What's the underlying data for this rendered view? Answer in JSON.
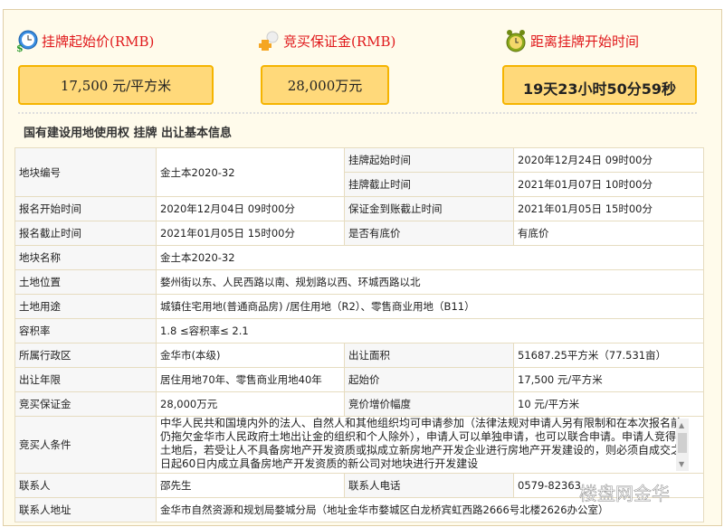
{
  "header": {
    "start_price": {
      "label": "挂牌起始价(RMB)",
      "value": "17,500 元/平方米",
      "icon": "clock-money-icon"
    },
    "deposit": {
      "label": "竞买保证金(RMB)",
      "value": "28,000万元",
      "icon": "money-bag-icon"
    },
    "countdown": {
      "label": "距离挂牌开始时间",
      "value": "19天23小时50分59秒",
      "icon": "alarm-clock-icon"
    }
  },
  "section_title": "国有建设用地使用权 挂牌 出让基本信息",
  "table": {
    "plot_no_label": "地块编号",
    "plot_no": "金土本2020-32",
    "list_start_label": "挂牌起始时间",
    "list_start": "2020年12月24日 09时00分",
    "list_end_label": "挂牌截止时间",
    "list_end": "2021年01月07日 10时00分",
    "reg_start_label": "报名开始时间",
    "reg_start": "2020年12月04日 09时00分",
    "deposit_deadline_label": "保证金到账截止时间",
    "deposit_deadline": "2021年01月05日 15时00分",
    "reg_end_label": "报名截止时间",
    "reg_end": "2021年01月05日 15时00分",
    "reserve_label": "是否有底价",
    "reserve": "有底价",
    "plot_name_label": "地块名称",
    "plot_name": "金土本2020-32",
    "location_label": "土地位置",
    "location": "婺州街以东、人民西路以南、规划路以西、环城西路以北",
    "usage_label": "土地用途",
    "usage": "城镇住宅用地(普通商品房) /居住用地（R2）、零售商业用地（B11）",
    "far_label": "容积率",
    "far": "1.8 ≤容积率≤ 2.1",
    "district_label": "所属行政区",
    "district": "金华市(本级)",
    "area_label": "出让面积",
    "area": "51687.25平方米（77.531亩）",
    "term_label": "出让年限",
    "term": "居住用地70年、零售商业用地40年",
    "start_price_label": "起始价",
    "start_price": "17,500 元/平方米",
    "deposit_label": "竞买保证金",
    "deposit": "28,000万元",
    "increment_label": "竞价增价幅度",
    "increment": "10 元/平方米",
    "conditions_label": "竞买人条件",
    "conditions": "中华人民共和国境内外的法人、自然人和其他组织均可申请参加（法律法规对申请人另有限制和在本次报名前仍拖欠金华市人民政府土地出让金的组织和个人除外），申请人可以单独申请，也可以联合申请。申请人竞得土地后，若受让人不具备房地产开发资质或拟成立新房地产开发企业进行房地产开发建设的，则必须自成交之日起60日内成立具备房地产开发资质的新公司对地块进行开发建设",
    "contact_label": "联系人",
    "contact": "邵先生",
    "phone_label": "联系人电话",
    "phone": "0579-82363",
    "address_label": "联系人地址",
    "address": "金华市自然资源和规划局婺城分局（地址金华市婺城区白龙桥宾虹西路2666号北楼2626办公室）"
  },
  "watermark": "楼盘网金华"
}
